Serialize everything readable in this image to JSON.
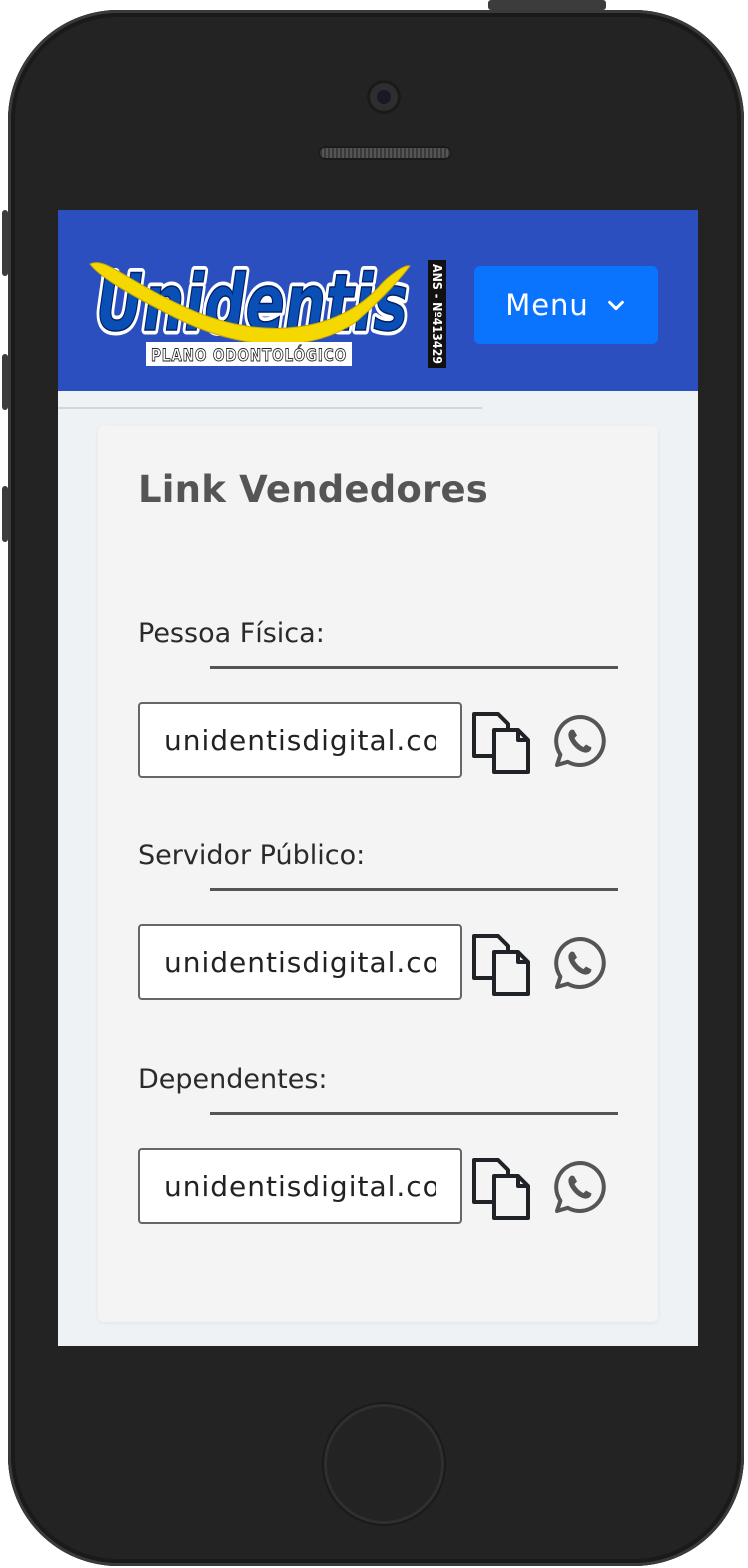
{
  "header": {
    "logo": {
      "brand": "Unidentis",
      "tagline": "PLANO ODONTOLÓGICO",
      "ans_badge": "ANS - Nº413429"
    },
    "menu_label": "Menu",
    "menu_icon": "chevron-down-icon"
  },
  "card": {
    "title": "Link Vendedores",
    "sections": [
      {
        "label": "Pessoa Física:",
        "link_value": "unidentisdigital.com.br",
        "copy_icon": "copy-icon",
        "share_icon": "whatsapp-icon"
      },
      {
        "label": "Servidor Público:",
        "link_value": "unidentisdigital.com.br",
        "copy_icon": "copy-icon",
        "share_icon": "whatsapp-icon"
      },
      {
        "label": "Dependentes:",
        "link_value": "unidentisdigital.com.br",
        "copy_icon": "copy-icon",
        "share_icon": "whatsapp-icon"
      }
    ]
  },
  "colors": {
    "header_bg": "#2b4fbf",
    "menu_button": "#0b74ff",
    "logo_blue": "#0a4fb5",
    "logo_yellow": "#f5d800",
    "page_bg": "#eef2f5",
    "card_bg": "#f4f4f4",
    "title_text": "#555555"
  }
}
